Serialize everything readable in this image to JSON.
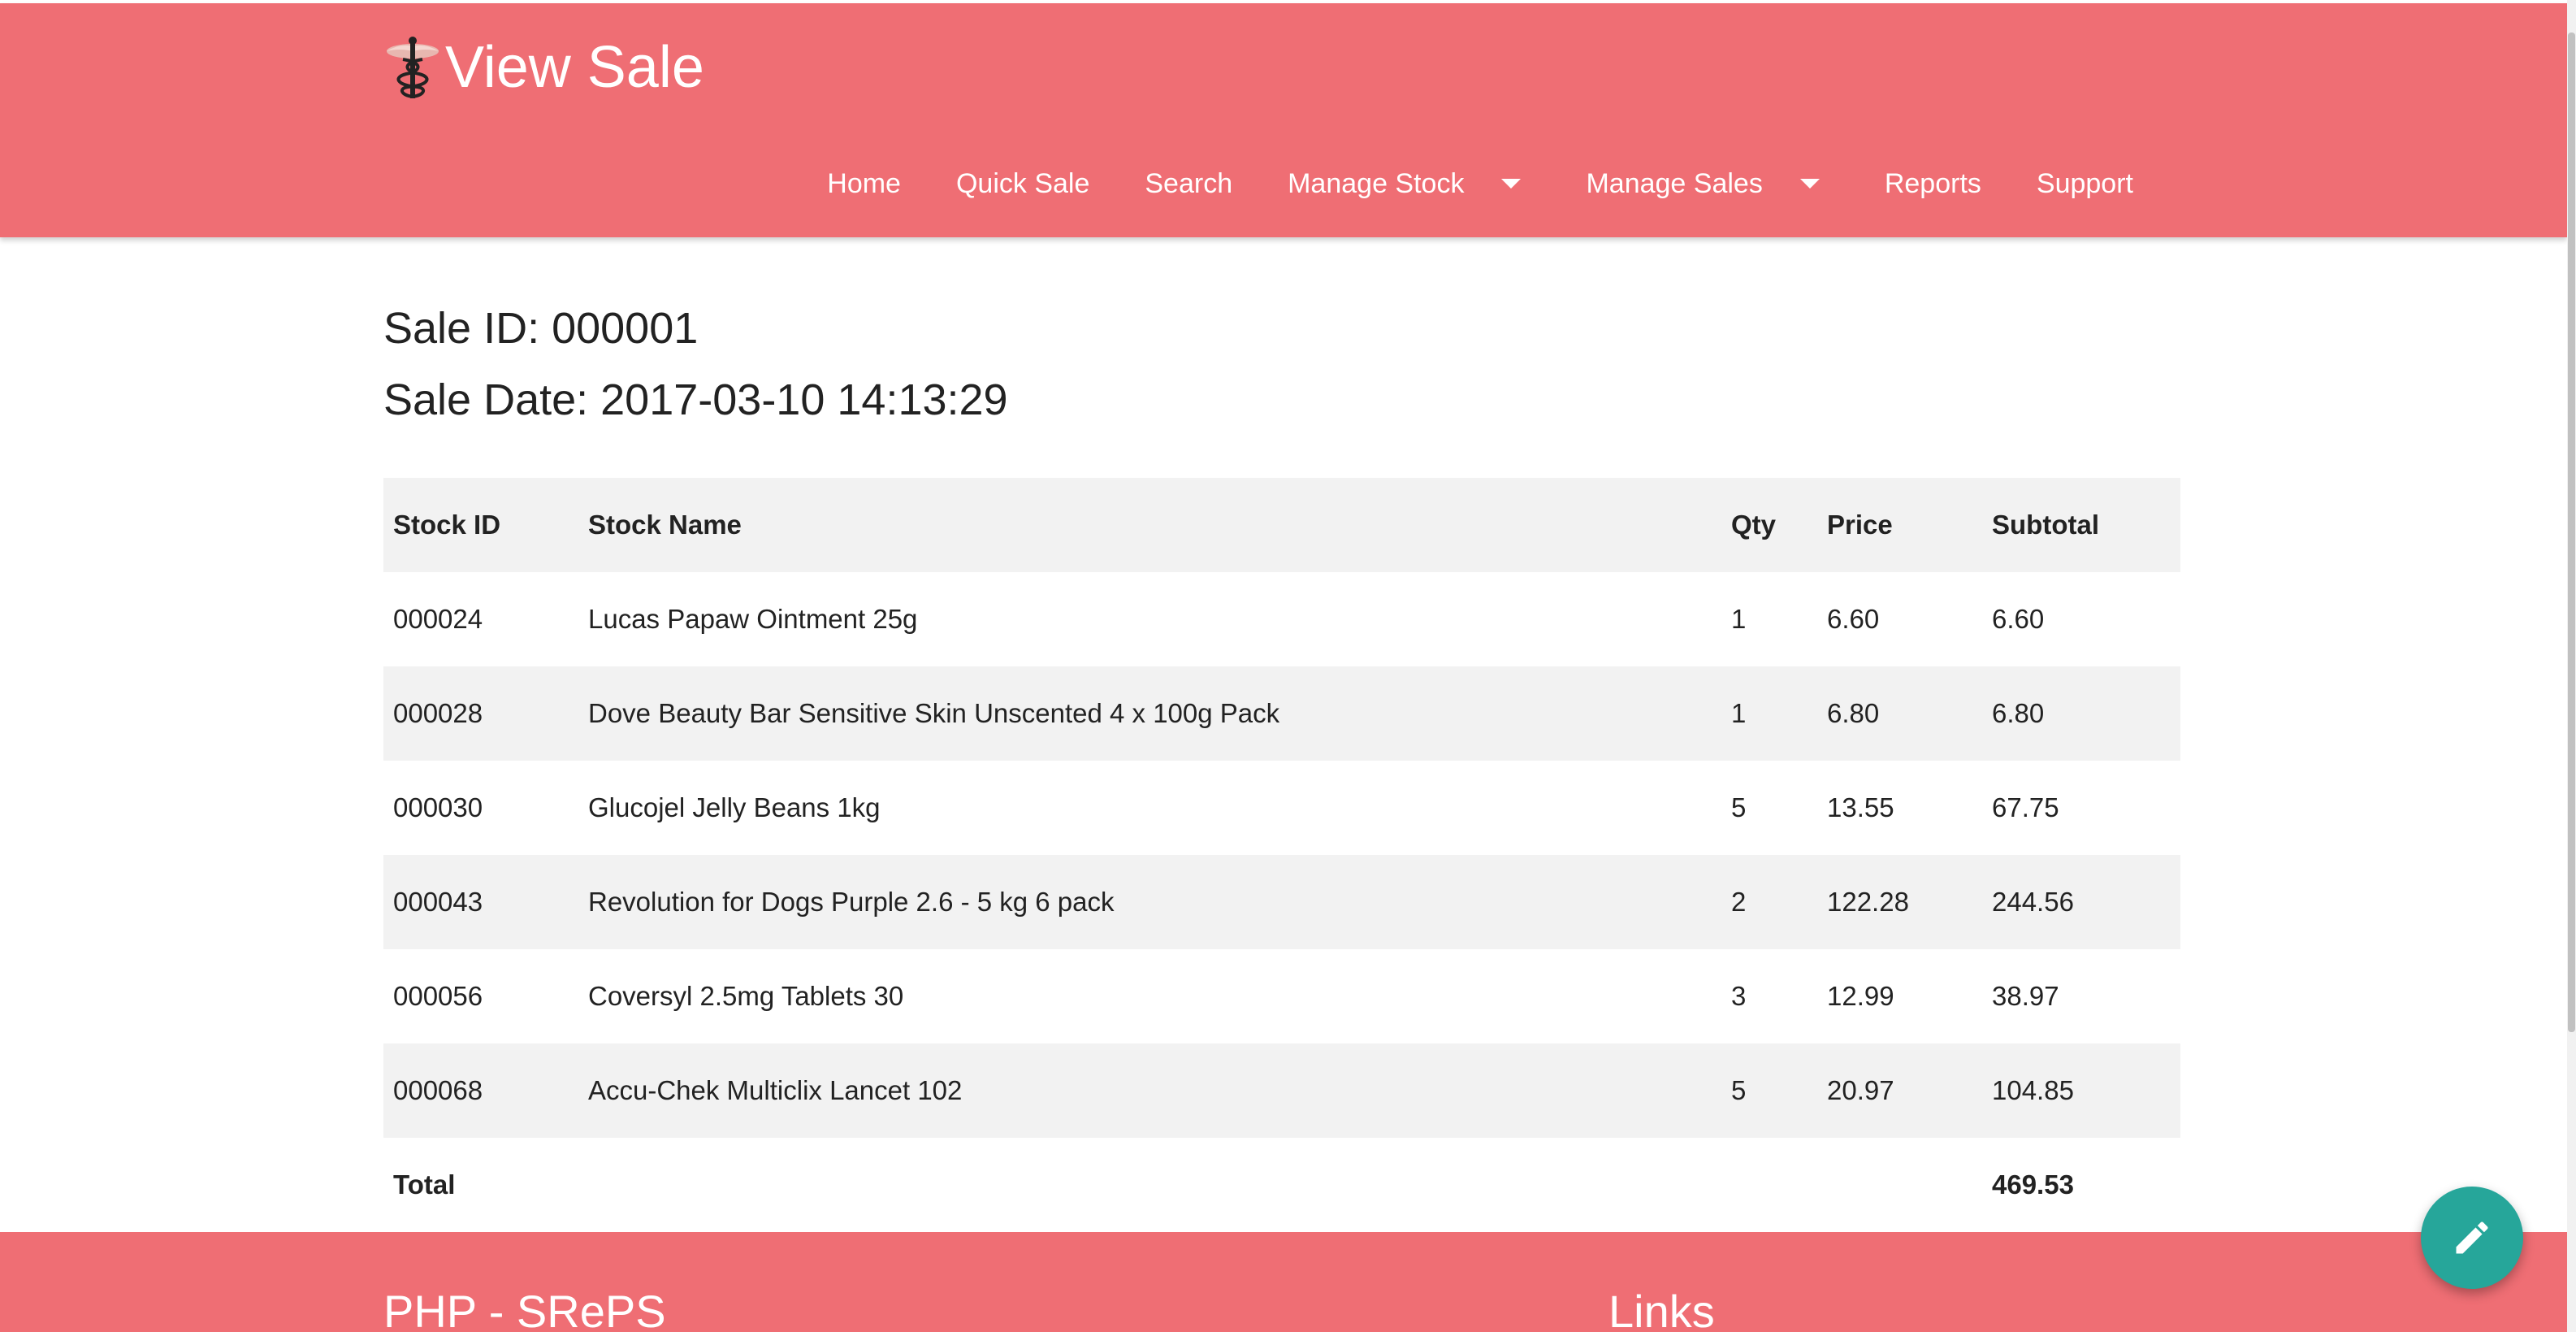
{
  "header": {
    "title": "View Sale",
    "logo_icon": "caduceus-icon",
    "background": "#ef6e74"
  },
  "nav": {
    "items": [
      {
        "label": "Home",
        "has_dropdown": false
      },
      {
        "label": "Quick Sale",
        "has_dropdown": false
      },
      {
        "label": "Search",
        "has_dropdown": false
      },
      {
        "label": "Manage Stock",
        "has_dropdown": true
      },
      {
        "label": "Manage Sales",
        "has_dropdown": true
      },
      {
        "label": "Reports",
        "has_dropdown": false
      },
      {
        "label": "Support",
        "has_dropdown": false
      }
    ]
  },
  "sale": {
    "id_label": "Sale ID: 000001",
    "date_label": "Sale Date: 2017-03-10 14:13:29"
  },
  "table": {
    "headers": [
      "Stock ID",
      "Stock Name",
      "Qty",
      "Price",
      "Subtotal"
    ],
    "rows": [
      [
        "000024",
        "Lucas Papaw Ointment 25g",
        "1",
        "6.60",
        "6.60"
      ],
      [
        "000028",
        "Dove Beauty Bar Sensitive Skin Unscented 4 x 100g Pack",
        "1",
        "6.80",
        "6.80"
      ],
      [
        "000030",
        "Glucojel Jelly Beans 1kg",
        "5",
        "13.55",
        "67.75"
      ],
      [
        "000043",
        "Revolution for Dogs Purple 2.6 - 5 kg 6 pack",
        "2",
        "122.28",
        "244.56"
      ],
      [
        "000056",
        "Coversyl 2.5mg Tablets 30",
        "3",
        "12.99",
        "38.97"
      ],
      [
        "000068",
        "Accu-Chek Multiclix Lancet 102",
        "5",
        "20.97",
        "104.85"
      ]
    ],
    "total_label": "Total",
    "total_value": "469.53"
  },
  "footer": {
    "left_title": "PHP - SRePS",
    "right_title": "Links"
  },
  "fab": {
    "icon": "pencil-icon",
    "color": "#26a69a"
  }
}
